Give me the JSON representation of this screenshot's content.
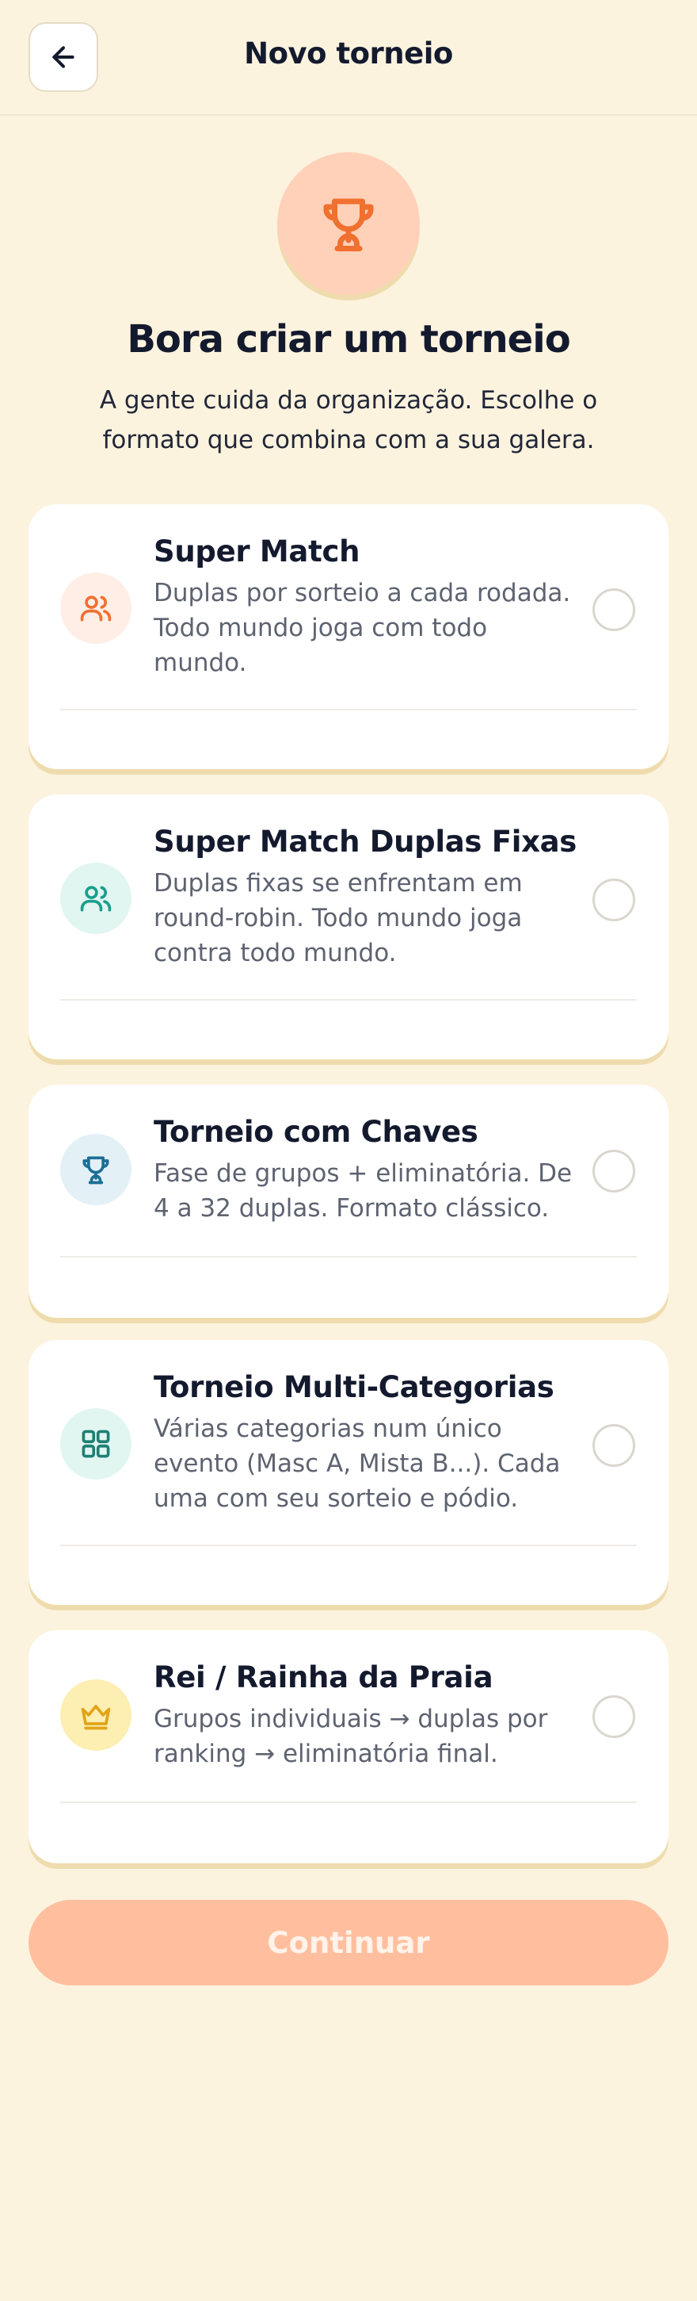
{
  "header": {
    "title": "Novo torneio",
    "back_icon": "arrow-left-icon"
  },
  "hero": {
    "icon": "trophy-icon",
    "title": "Bora criar um torneio",
    "subtitle": "A gente cuida da organização. Escolhe o formato que combina com a sua galera."
  },
  "formats": [
    {
      "title": "Super Match",
      "description": "Duplas por sorteio a cada rodada. Todo mundo joga com todo mundo.",
      "icon": "users-icon",
      "icon_color": "#f0702f",
      "icon_bg": "#feeee6",
      "selected": false
    },
    {
      "title": "Super Match Duplas Fixas",
      "description": "Duplas fixas se enfrentam em round-robin. Todo mundo joga contra todo mundo.",
      "icon": "users-icon",
      "icon_color": "#1a9e8c",
      "icon_bg": "#e1f6f1",
      "selected": false
    },
    {
      "title": "Torneio com Chaves",
      "description": "Fase de grupos + eliminatória. De 4 a 32 duplas. Formato clássico.",
      "icon": "trophy-icon",
      "icon_color": "#1b6f96",
      "icon_bg": "#e3f0f6",
      "selected": false
    },
    {
      "title": "Torneio Multi-Categorias",
      "description": "Várias categorias num único evento (Masc A, Mista B...). Cada uma com seu sorteio e pódio.",
      "icon": "grid-icon",
      "icon_color": "#1f7f74",
      "icon_bg": "#e1f6f1",
      "selected": false
    },
    {
      "title": "Rei / Rainha da Praia",
      "description": "Grupos individuais → duplas por ranking → eliminatória final.",
      "icon": "crown-icon",
      "icon_color": "#e0a416",
      "icon_bg": "#fdeeb2",
      "selected": false
    }
  ],
  "actions": {
    "continue_label": "Continuar",
    "continue_enabled": false
  },
  "colors": {
    "background": "#fcf3df",
    "accent": "#f0702f",
    "button_disabled": "#ffbf9f"
  }
}
